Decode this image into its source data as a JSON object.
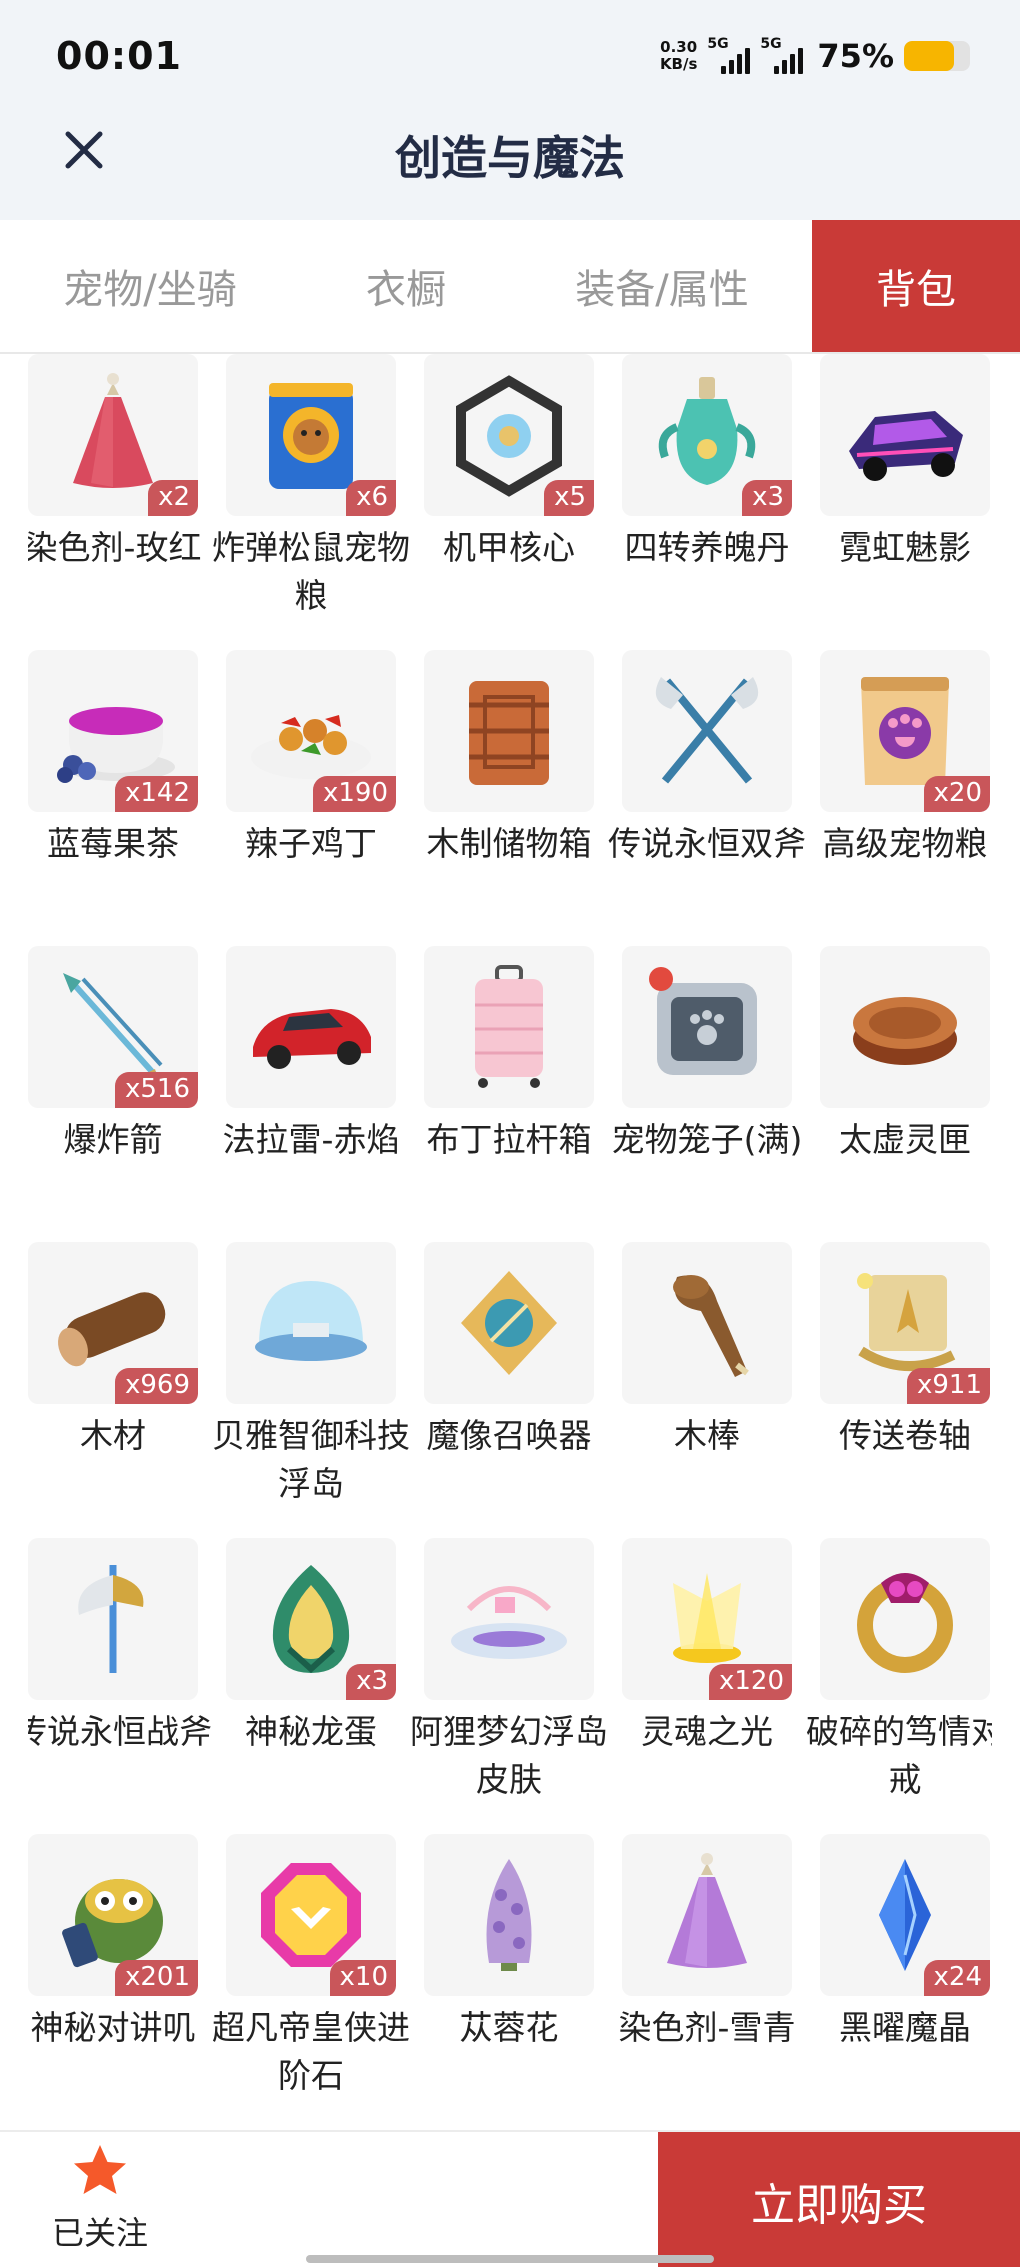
{
  "status": {
    "time": "00:01",
    "net_speed_value": "0.30",
    "net_speed_unit": "KB/s",
    "signal1": "5G",
    "signal2": "5G",
    "battery": "75%",
    "battery_level": 0.75,
    "battery_color": "#f7b500"
  },
  "header": {
    "close_icon": "close-icon",
    "title": "创造与魔法"
  },
  "tabs": [
    {
      "label": "宠物/坐骑",
      "active": false
    },
    {
      "label": "衣橱",
      "active": false
    },
    {
      "label": "装备/属性",
      "active": false
    },
    {
      "label": "背包",
      "active": true
    }
  ],
  "items": [
    {
      "name": "染色剂-玫红",
      "count": "x2",
      "icon": "dye-rose-icon"
    },
    {
      "name": "炸弹松鼠宠物粮",
      "count": "x6",
      "icon": "squirrel-food-icon"
    },
    {
      "name": "机甲核心",
      "count": "x5",
      "icon": "mecha-core-icon"
    },
    {
      "name": "四转养魄丹",
      "count": "x3",
      "icon": "potion-icon"
    },
    {
      "name": "霓虹魅影",
      "count": "",
      "icon": "neon-car-icon"
    },
    {
      "name": "蓝莓果茶",
      "count": "x142",
      "icon": "blueberry-tea-icon"
    },
    {
      "name": "辣子鸡丁",
      "count": "x190",
      "icon": "spicy-chicken-icon"
    },
    {
      "name": "木制储物箱",
      "count": "",
      "icon": "wooden-box-icon"
    },
    {
      "name": "传说永恒双斧",
      "count": "",
      "icon": "double-axe-icon"
    },
    {
      "name": "高级宠物粮",
      "count": "x20",
      "icon": "pet-food-icon"
    },
    {
      "name": "爆炸箭",
      "count": "x516",
      "icon": "arrow-icon"
    },
    {
      "name": "法拉雷-赤焰",
      "count": "",
      "icon": "red-car-icon"
    },
    {
      "name": "布丁拉杆箱",
      "count": "",
      "icon": "suitcase-icon"
    },
    {
      "name": "宠物笼子(满)",
      "count": "",
      "icon": "pet-cage-icon"
    },
    {
      "name": "太虚灵匣",
      "count": "",
      "icon": "spirit-box-icon"
    },
    {
      "name": "木材",
      "count": "x969",
      "icon": "log-icon"
    },
    {
      "name": "贝雅智御科技浮岛",
      "count": "",
      "icon": "dome-island-icon"
    },
    {
      "name": "魔像召唤器",
      "count": "",
      "icon": "golem-summoner-icon"
    },
    {
      "name": "木棒",
      "count": "",
      "icon": "club-icon"
    },
    {
      "name": "传送卷轴",
      "count": "x911",
      "icon": "scroll-icon"
    },
    {
      "name": "传说永恒战斧",
      "count": "",
      "icon": "battle-axe-icon"
    },
    {
      "name": "神秘龙蛋",
      "count": "x3",
      "icon": "dragon-egg-icon"
    },
    {
      "name": "阿狸梦幻浮岛皮肤",
      "count": "",
      "icon": "cloud-island-icon"
    },
    {
      "name": "灵魂之光",
      "count": "x120",
      "icon": "soul-light-icon"
    },
    {
      "name": "破碎的笃情对戒",
      "count": "",
      "icon": "broken-ring-icon"
    },
    {
      "name": "神秘对讲叽",
      "count": "x201",
      "icon": "walkie-bird-icon"
    },
    {
      "name": "超凡帝皇侠进阶石",
      "count": "x10",
      "icon": "advance-stone-icon"
    },
    {
      "name": "苁蓉花",
      "count": "",
      "icon": "cistanche-flower-icon"
    },
    {
      "name": "染色剂-雪青",
      "count": "",
      "icon": "dye-lilac-icon"
    },
    {
      "name": "黑曜魔晶",
      "count": "x24",
      "icon": "obsidian-crystal-icon"
    }
  ],
  "bottom": {
    "follow_icon": "star-icon",
    "follow_label": "已关注",
    "buy_label": "立即购买"
  },
  "colors": {
    "accent": "#c93a37",
    "count_badge": "#c9565a",
    "star": "#f5592a"
  }
}
